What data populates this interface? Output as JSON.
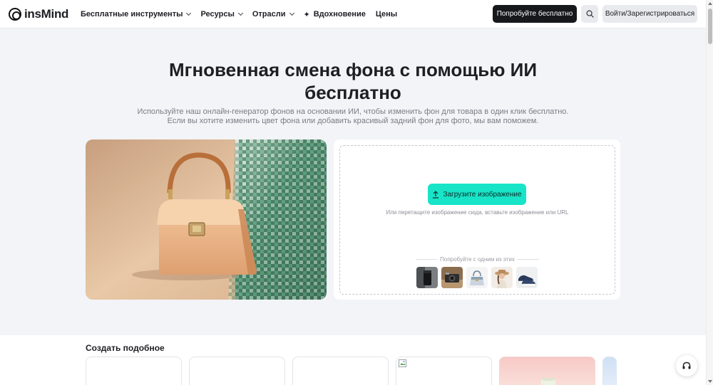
{
  "header": {
    "logo_text": "insMind",
    "nav": [
      {
        "label": "Бесплатные инструменты",
        "has_dropdown": true
      },
      {
        "label": "Ресурсы",
        "has_dropdown": true
      },
      {
        "label": "Отрасли",
        "has_dropdown": true
      },
      {
        "label": "Вдохновение",
        "has_dropdown": false
      },
      {
        "label": "Цены",
        "has_dropdown": false
      }
    ],
    "try_free_label": "Попробуйте бесплатно",
    "search_icon": "search-icon",
    "login_label": "Войти/Зарегистрироваться"
  },
  "hero": {
    "title_line1": "Мгновенная смена фона с помощью ИИ",
    "title_line2": "бесплатно",
    "subtitle_line1": "Используйте наш онлайн-генератор фонов на основании ИИ, чтобы изменить фон для товара в один клик бесплатно.",
    "subtitle_line2": "Если вы хотите изменить цвет фона или добавить красивый задний фон для фото, мы вам поможем."
  },
  "upload": {
    "button_label": "Загрузите изображение",
    "hint": "Или перетащите изображение сюда, вставьте изображение или URL",
    "samples_label": "Попробуйте с одним из этих",
    "samples": [
      "tumbler",
      "camera",
      "handbag",
      "woman-hat",
      "sneakers"
    ]
  },
  "section": {
    "title": "Создать подобное"
  },
  "colors": {
    "accent": "#18e4c7",
    "dark_button": "#17181c",
    "page_bg": "#f2f4f7"
  }
}
